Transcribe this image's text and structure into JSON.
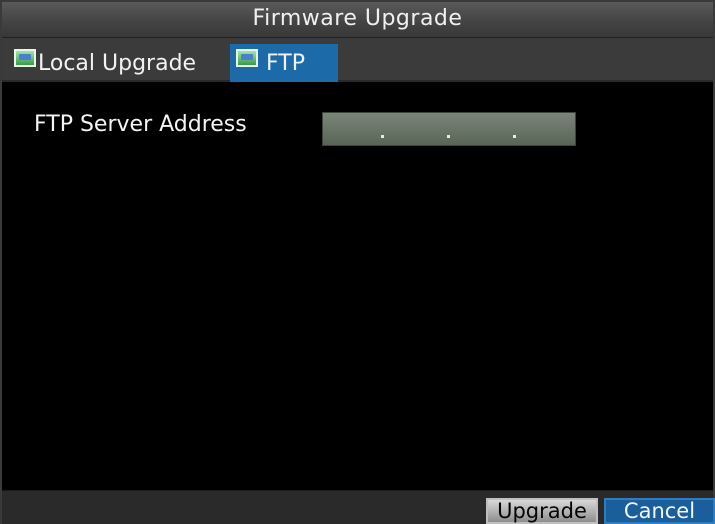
{
  "window": {
    "title": "Firmware Upgrade"
  },
  "tabs": [
    {
      "label": "Local Upgrade",
      "icon": "tab-image-icon",
      "active": false
    },
    {
      "label": "FTP",
      "icon": "tab-image-icon",
      "active": true
    }
  ],
  "form": {
    "ftp_server_label": "FTP Server Address",
    "ftp_server_value": " .  .  ."
  },
  "footer": {
    "upgrade_label": "Upgrade",
    "cancel_label": "Cancel"
  },
  "colors": {
    "active_tab": "#1c6aa8",
    "cancel_button": "#1a5e9c",
    "input_bg": "#6d776b"
  }
}
